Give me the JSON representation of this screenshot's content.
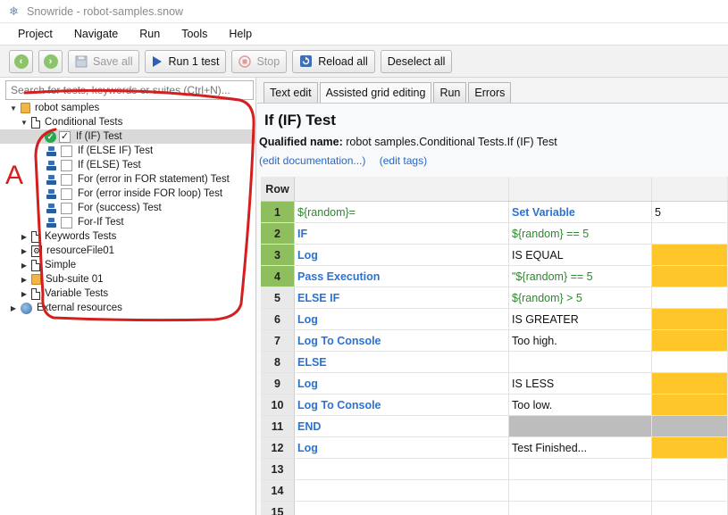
{
  "window": {
    "title": "Snowride - robot-samples.snow"
  },
  "menu": [
    "Project",
    "Navigate",
    "Run",
    "Tools",
    "Help"
  ],
  "toolbar": {
    "save_all": "Save all",
    "run": "Run 1 test",
    "stop": "Stop",
    "reload": "Reload all",
    "deselect": "Deselect all"
  },
  "search": {
    "placeholder": "Search for tests, keywords or suites (Ctrl+N)..."
  },
  "tree": {
    "root": "robot samples",
    "conditional": "Conditional Tests",
    "tests": [
      "If (IF) Test",
      "If (ELSE IF) Test",
      "If (ELSE) Test",
      "For (error in FOR statement) Test",
      "For (error inside FOR loop) Test",
      "For (success) Test",
      "For-If Test"
    ],
    "others": [
      "Keywords Tests",
      "resourceFile01",
      "Simple",
      "Sub-suite 01",
      "Variable Tests"
    ],
    "external": "External resources"
  },
  "annotation_letter": "A",
  "tabs": [
    "Text edit",
    "Assisted grid editing",
    "Run",
    "Errors"
  ],
  "editor": {
    "title": "If (IF) Test",
    "qualified_label": "Qualified name:",
    "qualified_value": "robot samples.Conditional Tests.If (IF) Test",
    "edit_doc": "(edit documentation...)",
    "edit_tags": "(edit tags)"
  },
  "grid": {
    "header": "Row",
    "rows": [
      {
        "n": "1",
        "c1": "${random}=",
        "c1s": "var",
        "c2": "Set Variable",
        "c2s": "kw",
        "c3": "5",
        "c3s": "plain",
        "hl": true
      },
      {
        "n": "2",
        "c1": "IF",
        "c1s": "kw",
        "c2": "${random} == 5",
        "c2s": "var",
        "c3": "",
        "hl": true
      },
      {
        "n": "3",
        "c1": "Log",
        "c1s": "kw",
        "c2": "IS EQUAL",
        "c2s": "plain",
        "c3": "",
        "c3bg": "yellow",
        "hl": true
      },
      {
        "n": "4",
        "c1": "Pass Execution",
        "c1s": "kw",
        "c2": "\"${random} == 5",
        "c2s": "var",
        "c3": "",
        "c3bg": "yellow",
        "hl": true
      },
      {
        "n": "5",
        "c1": "ELSE IF",
        "c1s": "kw",
        "c2": "${random} > 5",
        "c2s": "var",
        "c3": ""
      },
      {
        "n": "6",
        "c1": "Log",
        "c1s": "kw",
        "c2": "IS GREATER",
        "c2s": "plain",
        "c3": "",
        "c3bg": "yellow"
      },
      {
        "n": "7",
        "c1": "Log To Console",
        "c1s": "kw",
        "c2": "Too high.",
        "c2s": "plain",
        "c3": "",
        "c3bg": "yellow"
      },
      {
        "n": "8",
        "c1": "ELSE",
        "c1s": "kw",
        "c2": "",
        "c3": ""
      },
      {
        "n": "9",
        "c1": "Log",
        "c1s": "kw",
        "c2": "IS LESS",
        "c2s": "plain",
        "c3": "",
        "c3bg": "yellow"
      },
      {
        "n": "10",
        "c1": "Log To Console",
        "c1s": "kw",
        "c2": "Too low.",
        "c2s": "plain",
        "c3": "",
        "c3bg": "yellow"
      },
      {
        "n": "11",
        "c1": "END",
        "c1s": "kw",
        "c2": "",
        "c2bg": "grey",
        "c3": "",
        "c3bg": "grey"
      },
      {
        "n": "12",
        "c1": "Log",
        "c1s": "kw",
        "c2": "Test Finished...",
        "c2s": "plain",
        "c3": "",
        "c3bg": "yellow"
      },
      {
        "n": "13",
        "c1": "",
        "c2": "",
        "c3": ""
      },
      {
        "n": "14",
        "c1": "",
        "c2": "",
        "c3": ""
      },
      {
        "n": "15",
        "c1": "",
        "c2": "",
        "c3": ""
      }
    ]
  }
}
